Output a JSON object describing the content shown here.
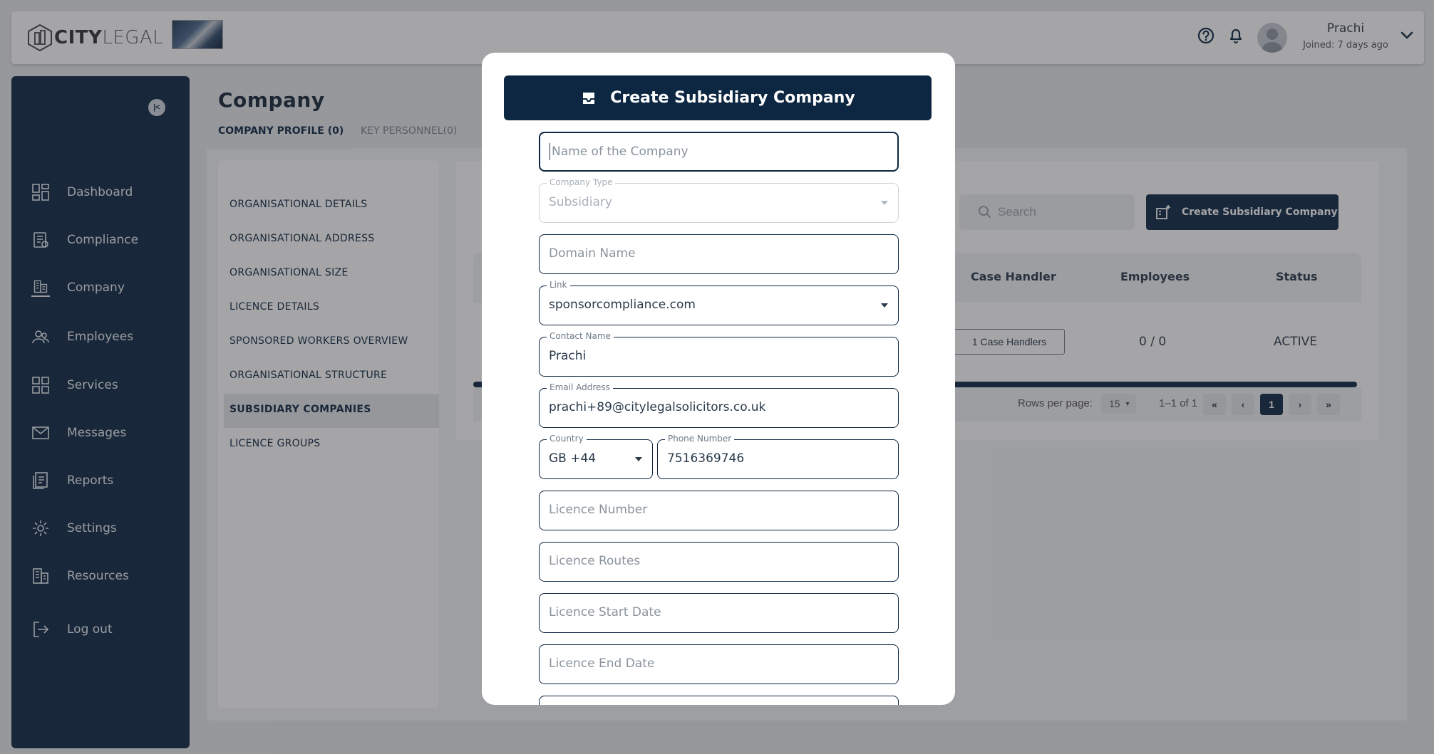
{
  "header": {
    "logo_bold": "CITY",
    "logo_light": "LEGAL",
    "user_name": "Prachi",
    "user_joined": "Joined: 7 days ago"
  },
  "sidebar": {
    "items": [
      {
        "label": "Dashboard",
        "icon": "dashboard-icon"
      },
      {
        "label": "Compliance",
        "icon": "compliance-icon"
      },
      {
        "label": "Company",
        "icon": "company-icon"
      },
      {
        "label": "Employees",
        "icon": "employees-icon"
      },
      {
        "label": "Services",
        "icon": "services-icon"
      },
      {
        "label": "Messages",
        "icon": "messages-icon"
      },
      {
        "label": "Reports",
        "icon": "reports-icon"
      },
      {
        "label": "Settings",
        "icon": "settings-icon"
      },
      {
        "label": "Resources",
        "icon": "resources-icon"
      },
      {
        "label": "Log out",
        "icon": "logout-icon"
      }
    ],
    "active": "Company"
  },
  "page": {
    "title": "Company",
    "tabs": [
      {
        "label": "COMPANY PROFILE (0)",
        "active": true
      },
      {
        "label": "KEY PERSONNEL(0)",
        "active": false
      }
    ]
  },
  "left_menu": {
    "items": [
      "ORGANISATIONAL DETAILS",
      "ORGANISATIONAL ADDRESS",
      "ORGANISATIONAL SIZE",
      "LICENCE DETAILS",
      "SPONSORED WORKERS OVERVIEW",
      "ORGANISATIONAL STRUCTURE",
      "SUBSIDIARY COMPANIES",
      "LICENCE GROUPS"
    ],
    "active": "SUBSIDIARY COMPANIES"
  },
  "table": {
    "search_placeholder": "Search",
    "create_label": "Create Subsidiary Company",
    "columns": [
      "Case Handler",
      "Employees",
      "Status"
    ],
    "rows": [
      {
        "case_handler": "1 Case Handlers",
        "employees": "0 / 0",
        "status": "ACTIVE"
      }
    ],
    "rows_per_page_label": "Rows per page:",
    "rows_per_page": "15",
    "range": "1–1 of 1",
    "current_page": "1"
  },
  "modal": {
    "title": "Create Subsidiary Company",
    "fields": {
      "company_name": {
        "placeholder": "Name of the Company",
        "value": ""
      },
      "company_type": {
        "label": "Company Type",
        "value": "Subsidiary"
      },
      "domain": {
        "placeholder": "Domain Name",
        "value": ""
      },
      "link": {
        "label": "Link",
        "value": "sponsorcompliance.com"
      },
      "contact_name": {
        "label": "Contact Name",
        "value": "Prachi"
      },
      "email": {
        "label": "Email Address",
        "value": "prachi+89@citylegalsolicitors.co.uk"
      },
      "country": {
        "label": "Country",
        "value": "GB +44"
      },
      "phone": {
        "label": "Phone Number",
        "value": "7516369746"
      },
      "licence_number": {
        "placeholder": "Licence Number"
      },
      "licence_routes": {
        "placeholder": "Licence Routes"
      },
      "licence_start": {
        "placeholder": "Licence Start Date"
      },
      "licence_end": {
        "placeholder": "Licence End Date"
      }
    }
  },
  "colors": {
    "primary": "#0d2742",
    "overlay": "rgba(40,40,45,0.42)"
  }
}
